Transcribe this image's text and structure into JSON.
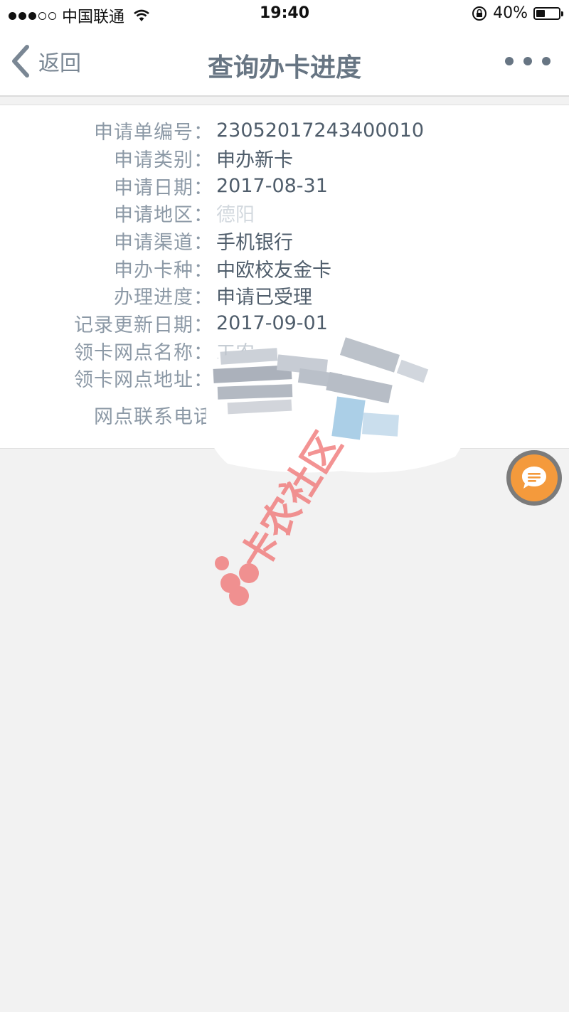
{
  "status_bar": {
    "carrier": "中国联通",
    "time": "19:40",
    "battery_text": "40%",
    "battery_level": 0.4
  },
  "nav": {
    "back_label": "返回",
    "title": "查询办卡进度"
  },
  "details": [
    {
      "label": "申请单编号：",
      "value": "23052017243400010"
    },
    {
      "label": "申请类别：",
      "value": "申办新卡"
    },
    {
      "label": "申请日期：",
      "value": "2017-08-31"
    },
    {
      "label": "申请地区：",
      "value": "德阳"
    },
    {
      "label": "申请渠道：",
      "value": "手机银行"
    },
    {
      "label": "申办卡种：",
      "value": "中欧校友金卡"
    },
    {
      "label": "办理进度：",
      "value": "申请已受理"
    },
    {
      "label": "记录更新日期：",
      "value": "2017-09-01"
    },
    {
      "label": "领卡网点名称：",
      "value": "工农"
    },
    {
      "label": "领卡网点地址：",
      "value": ""
    },
    {
      "label": "网点联系电话",
      "value": ""
    }
  ],
  "watermark": {
    "text": "卡农社区"
  },
  "colors": {
    "accent_orange": "#f49a3c",
    "label_gray": "#8c99a6",
    "value_dark": "#4f5d6b",
    "watermark_pink": "#f07070"
  },
  "icons": {
    "back": "chevron-left-icon",
    "more": "more-dots-icon",
    "chat": "chat-bubble-icon",
    "wifi": "wifi-icon",
    "lock": "rotation-lock-icon"
  }
}
